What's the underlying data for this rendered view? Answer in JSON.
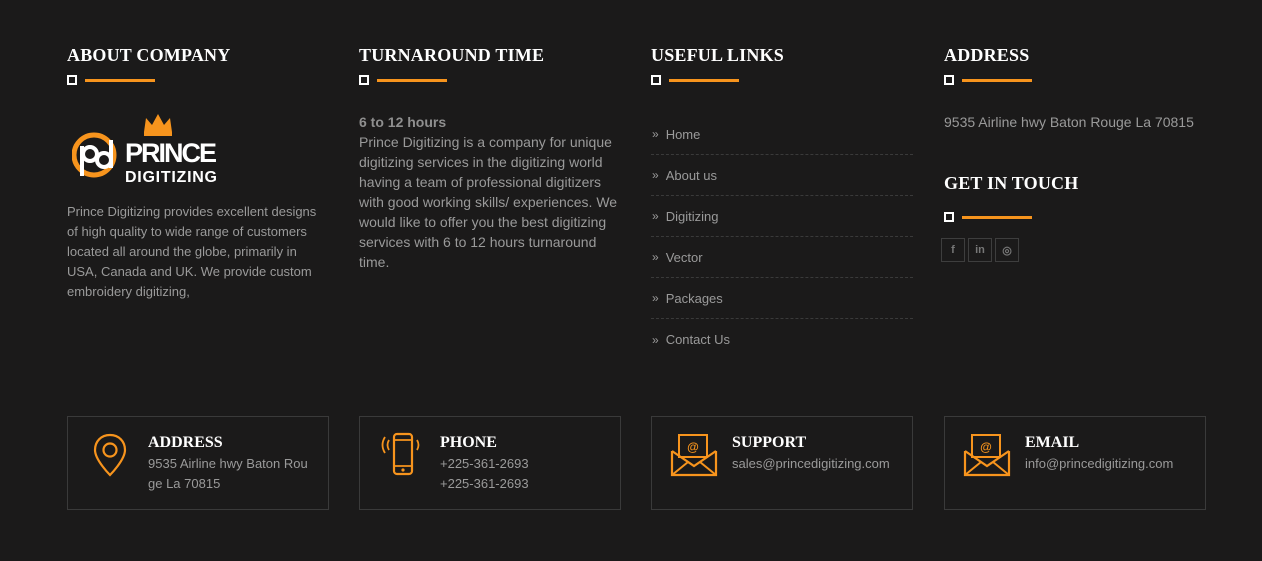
{
  "about": {
    "heading": "ABOUT COMPANY",
    "logo_word1": "PRINCE",
    "logo_word2": "DIGITIZING",
    "text": "Prince Digitizing provides excellent designs of high quality to wide range of customers located all around the globe, primarily in USA, Canada and UK. We provide custom embroidery digitizing,"
  },
  "turnaround": {
    "heading": "TURNAROUND TIME",
    "bold": "6 to 12 hours",
    "text": "Prince Digitizing is a company for unique digitizing services in the digitizing world having a team of professional digitizers with good working skills/ experiences. We would like to offer you the best digitizing services with 6 to 12 hours turnaround time."
  },
  "links": {
    "heading": "USEFUL LINKS",
    "items": [
      {
        "label": "Home"
      },
      {
        "label": "About us"
      },
      {
        "label": "Digitizing"
      },
      {
        "label": "Vector"
      },
      {
        "label": "Packages"
      },
      {
        "label": "Contact Us"
      }
    ]
  },
  "address_col": {
    "heading": "ADDRESS",
    "text": "9535 Airline hwy Baton Rouge La 70815",
    "touch_heading": "GET IN TOUCH",
    "socials": [
      {
        "glyph": "f",
        "icon": "facebook-icon"
      },
      {
        "glyph": "in",
        "icon": "linkedin-icon"
      },
      {
        "glyph": "◎",
        "icon": "instagram-icon"
      }
    ]
  },
  "cards": {
    "address": {
      "title": "ADDRESS",
      "line1": "9535 Airline hwy Baton Rou",
      "line2": "ge La 70815"
    },
    "phone": {
      "title": "PHONE",
      "line1": "+225-361-2693",
      "line2": "+225-361-2693"
    },
    "support": {
      "title": "SUPPORT",
      "line1": "sales@princedigitizing.com"
    },
    "email": {
      "title": "EMAIL",
      "line1": "info@princedigitizing.com"
    }
  },
  "colors": {
    "accent": "#f7941d",
    "background": "#1b1a1a",
    "text": "#9a9a9a"
  }
}
